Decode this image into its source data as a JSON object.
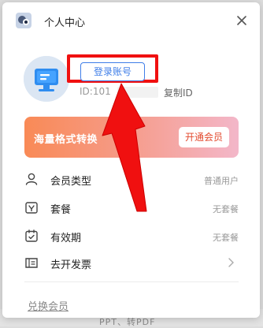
{
  "window": {
    "title": "个人中心"
  },
  "account": {
    "login_label": "登录账号",
    "uid_label": "ID:101",
    "copy_id_label": "复制ID"
  },
  "banner": {
    "text": "海量格式转换",
    "button_label": "开通会员"
  },
  "menu": [
    {
      "label": "会员类型",
      "value": "普通用户",
      "icon": "user-icon"
    },
    {
      "label": "套餐",
      "value": "无套餐",
      "icon": "package-icon"
    },
    {
      "label": "有效期",
      "value": "无套餐",
      "icon": "calendar-icon"
    },
    {
      "label": "去开发票",
      "value": "",
      "icon": "invoice-icon"
    }
  ],
  "footer": {
    "redeem_label": "兑换会员"
  },
  "background": {
    "peek_text": "PPT、转PDF"
  },
  "colors": {
    "accent": "#3f7ee8",
    "highlight_red": "#f01010",
    "vip_text": "#e34a2e"
  }
}
